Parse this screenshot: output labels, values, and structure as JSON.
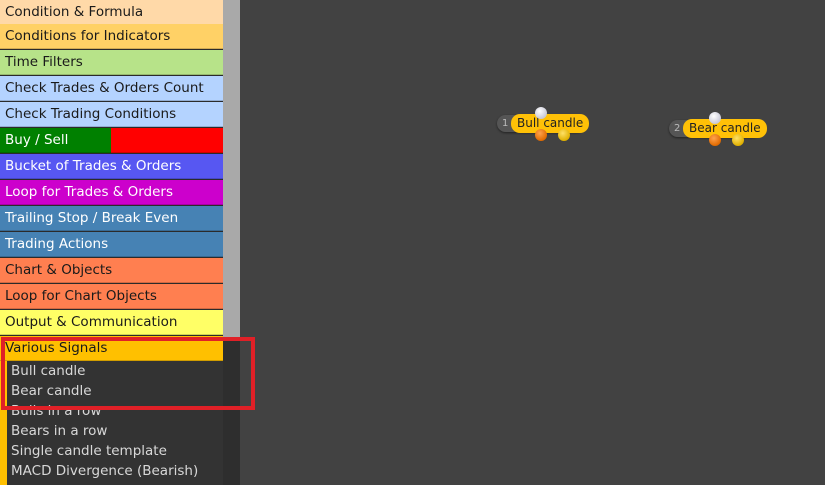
{
  "sidebar": {
    "categories": [
      {
        "label": "Condition & Formula",
        "color": "#ffd9a8"
      },
      {
        "label": "Conditions for Indicators",
        "color": "#ffd166"
      },
      {
        "label": "Time Filters",
        "color": "#b7e389"
      },
      {
        "label": "Check Trades & Orders Count",
        "color": "#b4d3ff"
      },
      {
        "label": "Check Trading Conditions",
        "color": "#b4d3ff"
      },
      {
        "label": "Buy / Sell",
        "color_left": "#008000",
        "color_right": "#ff0000"
      },
      {
        "label": "Bucket of Trades & Orders",
        "color": "#5757f2"
      },
      {
        "label": "Loop for Trades & Orders",
        "color": "#cc00cc"
      },
      {
        "label": "Trailing Stop / Break Even",
        "color": "#4682b4"
      },
      {
        "label": "Trading Actions",
        "color": "#4682b4"
      },
      {
        "label": "Chart & Objects",
        "color": "#ff7f50"
      },
      {
        "label": "Loop for Chart Objects",
        "color": "#ff7f50"
      },
      {
        "label": "Output & Communication",
        "color": "#ffff66"
      },
      {
        "label": "Various Signals",
        "color": "#ffc000"
      }
    ],
    "subitems": [
      "Bull candle",
      "Bear candle",
      "Bulls in a row",
      "Bears in a row",
      "Single candle template",
      "MACD Divergence (Bearish)"
    ]
  },
  "canvas": {
    "nodes": [
      {
        "number": "1",
        "label": "Bull candle"
      },
      {
        "number": "2",
        "label": "Bear candle"
      }
    ]
  },
  "colors": {
    "canvas_bg": "#424242",
    "highlight": "#e02027",
    "node_label_bg": "#ffc107"
  }
}
